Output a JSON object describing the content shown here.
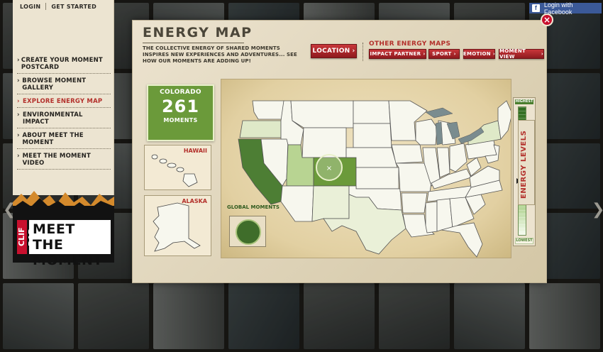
{
  "topnav": {
    "login": "LOGIN",
    "get_started": "GET STARTED"
  },
  "menu": [
    {
      "label": "CREATE YOUR MOMENT POSTCARD",
      "active": false
    },
    {
      "label": "BROWSE MOMENT GALLERY",
      "active": false
    },
    {
      "label": "EXPLORE ENERGY MAP",
      "active": true
    },
    {
      "label": "ENVIRONMENTAL IMPACT",
      "active": false
    },
    {
      "label": "ABOUT MEET THE MOMENT",
      "active": false
    },
    {
      "label": "MEET THE MOMENT VIDEO",
      "active": false
    }
  ],
  "brand": {
    "clif": "CLIF BAR",
    "line1": "MEET THE",
    "line2": "MOMENT"
  },
  "facebook": {
    "label": "Login with Facebook"
  },
  "panel": {
    "title": "ENERGY MAP",
    "subtitle": "THE COLLECTIVE ENERGY OF SHARED MOMENTS INSPIRES NEW EXPERIENCES AND ADVENTURES... SEE HOW OUR MOMENTS ARE ADDING UP!",
    "location_button": "LOCATION",
    "other_maps_title": "OTHER ENERGY MAPS",
    "other_maps": [
      "IMPACT PARTNER",
      "SPORT",
      "EMOTION",
      "MOMENT VIEW"
    ]
  },
  "selected_state": {
    "name": "COLORADO",
    "count": "261",
    "unit": "MOMENTS"
  },
  "insets": {
    "hawaii": "HAWAII",
    "alaska": "ALASKA",
    "global": "GLOBAL MOMENTS"
  },
  "scale": {
    "highest": "HIGHEST",
    "lowest": "LOWEST",
    "title": "ENERGY LEVELS"
  },
  "colors": {
    "accent_red": "#b3302b",
    "energy_green": "#6b9a3a",
    "facebook_blue": "#3b5998"
  },
  "icons": [
    "close-icon",
    "facebook-icon",
    "chevron-right-icon",
    "globe-icon",
    "zoom-target-icon"
  ]
}
